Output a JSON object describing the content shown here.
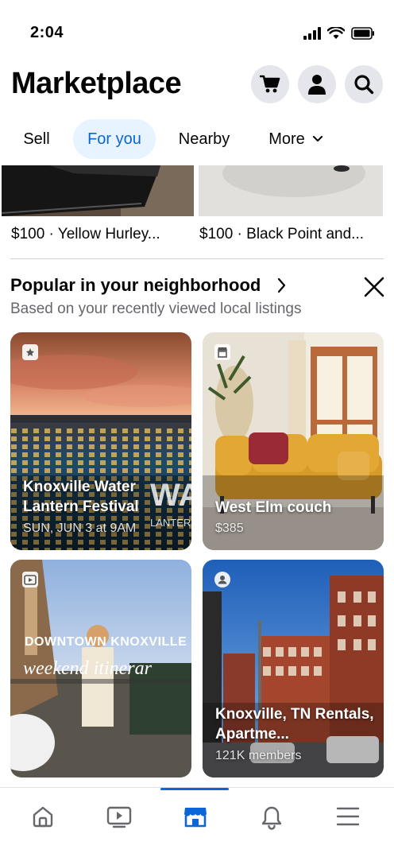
{
  "status_bar": {
    "time": "2:04"
  },
  "header": {
    "title": "Marketplace"
  },
  "tabs": [
    {
      "label": "Sell"
    },
    {
      "label": "For you"
    },
    {
      "label": "Nearby"
    },
    {
      "label": "More"
    }
  ],
  "top_listings": [
    {
      "caption": "$100 · Yellow Hurley..."
    },
    {
      "caption": "$100 · Black Point and..."
    }
  ],
  "section": {
    "title": "Popular in your neighborhood",
    "subtitle": "Based on your recently viewed local listings"
  },
  "cards": [
    {
      "title": "Knoxville Water Lantern Festival",
      "meta": "SUN, JUN 3 at 9AM",
      "overlay_text": "WAT",
      "overlay_sub": "LANTERN",
      "badge": "event-icon"
    },
    {
      "title": "West Elm couch",
      "meta": "$385",
      "badge": "shop-icon"
    },
    {
      "title": "",
      "overlay_text": "DOWNTOWN KNOXVILLE",
      "overlay_script": "weekend itinerar",
      "badge": "video-icon"
    },
    {
      "title": "Knoxville, TN Rentals, Apartme...",
      "meta": "121K members",
      "badge": "group-icon"
    }
  ],
  "colors": {
    "accent": "#0a66d8",
    "tab_active_bg": "#e7f3ff",
    "button_bg": "#e4e6eb"
  }
}
